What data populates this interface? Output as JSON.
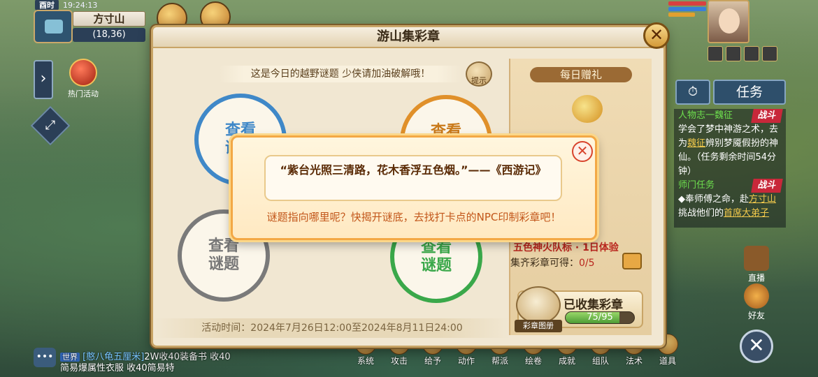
{
  "hud": {
    "period": "酉时",
    "time": "19:24:13",
    "location": "方寸山",
    "coords": "(18,36)",
    "hot_activity": "热门活动"
  },
  "dialog": {
    "title": "游山集彩章",
    "riddle_banner": "这是今日的越野谜题 少侠请加油破解哦！",
    "hint_label": "提示",
    "circles": [
      {
        "label_top": "查看",
        "label_bottom": "谜题",
        "color": "#3f88c8"
      },
      {
        "label_top": "查看",
        "label_bottom": "谜题",
        "color": "#e0902a"
      },
      {
        "label_top": "查看",
        "label_bottom": "谜题",
        "color": "#7a7a7a"
      },
      {
        "label_top": "查看",
        "label_bottom": "谜题",
        "color": "#3aa84a"
      }
    ],
    "activity_time": "活动时间：2024年7月26日12:00至2024年8月11日24:00",
    "daily_gift": "每日赠礼",
    "reward": "五色神火队标 · 1日体验",
    "stamp_label": "集齐彩章可得：",
    "stamp_count": "0/5",
    "collected_title": "已收集彩章",
    "collected_progress": "75/95",
    "progress_fraction": 0.789,
    "book_label": "彩章图册"
  },
  "popup": {
    "quote": "“紫台光照三清路，花木香浮五色烟。”——《西游记》",
    "hint": "谜题指向哪里呢？快揭开谜底，去找打卡点的NPC印制彩章吧！"
  },
  "right_hud": {
    "task_tab": "任务",
    "quests": [
      {
        "title": "人物志一魏征",
        "tag": "战斗",
        "text_a": "学会了梦中神游之术，去为",
        "link": "魏征",
        "text_b": "辨别梦魇假扮的神仙。（任务剩余时间54分钟）"
      },
      {
        "title": "师门任务",
        "tag": "战斗",
        "text_a": "◆奉师傅之命，赴",
        "link": "方寸山",
        "text_b": "挑战他们的",
        "link2": "首席大弟子"
      }
    ],
    "live_label": "直播",
    "friends_label": "好友"
  },
  "chat": {
    "channel": "世界",
    "name": "[憨八龟五厘米]",
    "message": "2W收40装备书 收40简易爆属性衣服 收40简易特"
  },
  "bottom_bar": [
    "系统",
    "攻击",
    "给予",
    "动作",
    "帮派",
    "绘卷",
    "成就",
    "组队",
    "法术",
    "道具"
  ],
  "colors": {
    "accent": "#c8a466",
    "warning": "#c8283a",
    "progress": "#4d9c35"
  }
}
